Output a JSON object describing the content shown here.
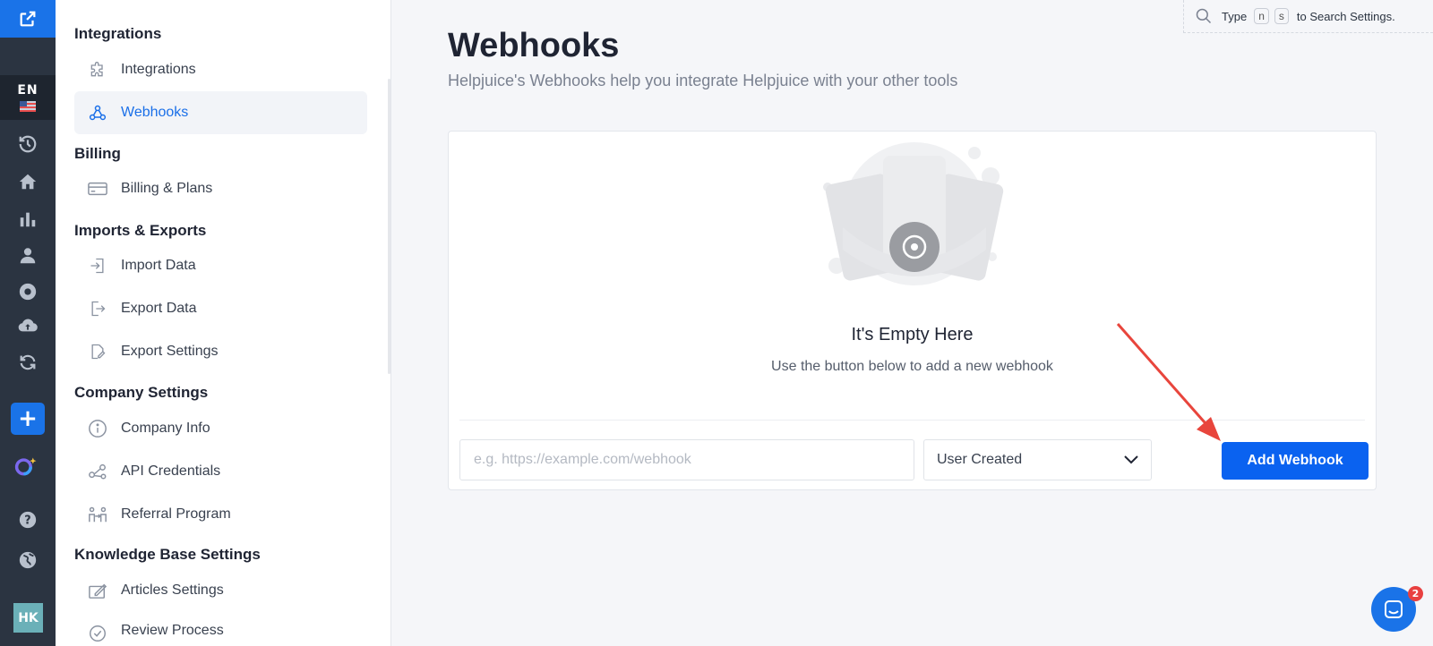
{
  "rail": {
    "lang_code": "EN",
    "plus_label": "+",
    "avatar_initials": "HK",
    "icons": [
      "external-link-icon",
      "history-icon",
      "home-icon",
      "analytics-icon",
      "users-icon",
      "explore-icon",
      "cloud-upload-icon",
      "sync-icon",
      "ai-assistant-icon",
      "help-icon",
      "globe-icon"
    ]
  },
  "search": {
    "prefix": "Type",
    "key1": "n",
    "key2": "s",
    "suffix": "to Search Settings."
  },
  "nav": {
    "sections": [
      {
        "title": "Integrations",
        "items": [
          {
            "label": "Integrations",
            "icon": "puzzle-icon"
          },
          {
            "label": "Webhooks",
            "icon": "webhook-icon",
            "active": true
          }
        ]
      },
      {
        "title": "Billing",
        "items": [
          {
            "label": "Billing & Plans",
            "icon": "credit-card-icon"
          }
        ]
      },
      {
        "title": "Imports & Exports",
        "items": [
          {
            "label": "Import Data",
            "icon": "import-icon"
          },
          {
            "label": "Export Data",
            "icon": "export-icon"
          },
          {
            "label": "Export Settings",
            "icon": "export-settings-icon"
          }
        ]
      },
      {
        "title": "Company Settings",
        "items": [
          {
            "label": "Company Info",
            "icon": "info-icon"
          },
          {
            "label": "API Credentials",
            "icon": "api-icon"
          },
          {
            "label": "Referral Program",
            "icon": "referral-icon"
          }
        ]
      },
      {
        "title": "Knowledge Base Settings",
        "items": [
          {
            "label": "Articles Settings",
            "icon": "edit-icon"
          },
          {
            "label": "Review Process",
            "icon": "review-icon"
          }
        ]
      }
    ]
  },
  "main": {
    "title": "Webhooks",
    "subtitle": "Helpjuice's Webhooks help you integrate Helpjuice with your other tools",
    "empty_title": "It's Empty Here",
    "empty_subtitle": "Use the button below to add a new webhook",
    "url_placeholder": "e.g. https://example.com/webhook",
    "event_select": "User Created",
    "add_button": "Add Webhook"
  },
  "chat": {
    "badge_count": "2"
  },
  "colors": {
    "accent": "#0a62f0",
    "rail": "#2b3441",
    "badge": "#e84040",
    "annotation_arrow": "#e8453c"
  }
}
